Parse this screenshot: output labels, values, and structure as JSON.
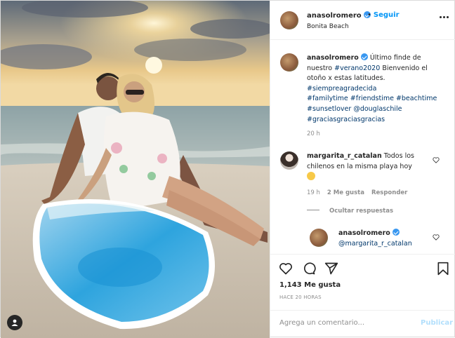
{
  "post": {
    "username": "anasolromero",
    "follow_label": "Seguir",
    "location": "Bonita Beach"
  },
  "caption": {
    "username": "anasolromero",
    "text_1": "Último finde de",
    "text_2": "nuestro",
    "tag_verano": "#verano2020",
    "text_3": "Bienvenido el",
    "text_4": "otoño x estas latitudes.",
    "tags_line1": "#siempreagradecida",
    "tags_line2": "#familytime #friendstime #beachtime",
    "tags_line3": "#sunsetlover @douglaschile",
    "tags_line4": "#graciasgraciasgracias",
    "age": "20 h"
  },
  "comment1": {
    "username": "margarita_r_catalan",
    "text_1": "Todos los",
    "text_2": "chilenos en la misma playa hoy",
    "age": "19 h",
    "likes": "2 Me gusta",
    "reply_label": "Responder",
    "hide_replies": "Ocultar respuestas"
  },
  "reply1": {
    "username": "anasolromero",
    "mention": "@margarita_r_catalan"
  },
  "actions": {
    "likes": "1,143 Me gusta",
    "timestamp": "HACE 20 HORAS"
  },
  "composer": {
    "placeholder": "Agrega un comentario...",
    "publish_label": "Publicar"
  },
  "colors": {
    "link": "#0095f6",
    "hashtag": "#00376b",
    "verified": "#3897f0",
    "muted": "#8e8e8e"
  },
  "icons": [
    "user-tag-icon",
    "verified-icon",
    "more-options-icon",
    "heart-icon",
    "comment-icon",
    "share-icon",
    "bookmark-icon",
    "smile-emoji"
  ]
}
